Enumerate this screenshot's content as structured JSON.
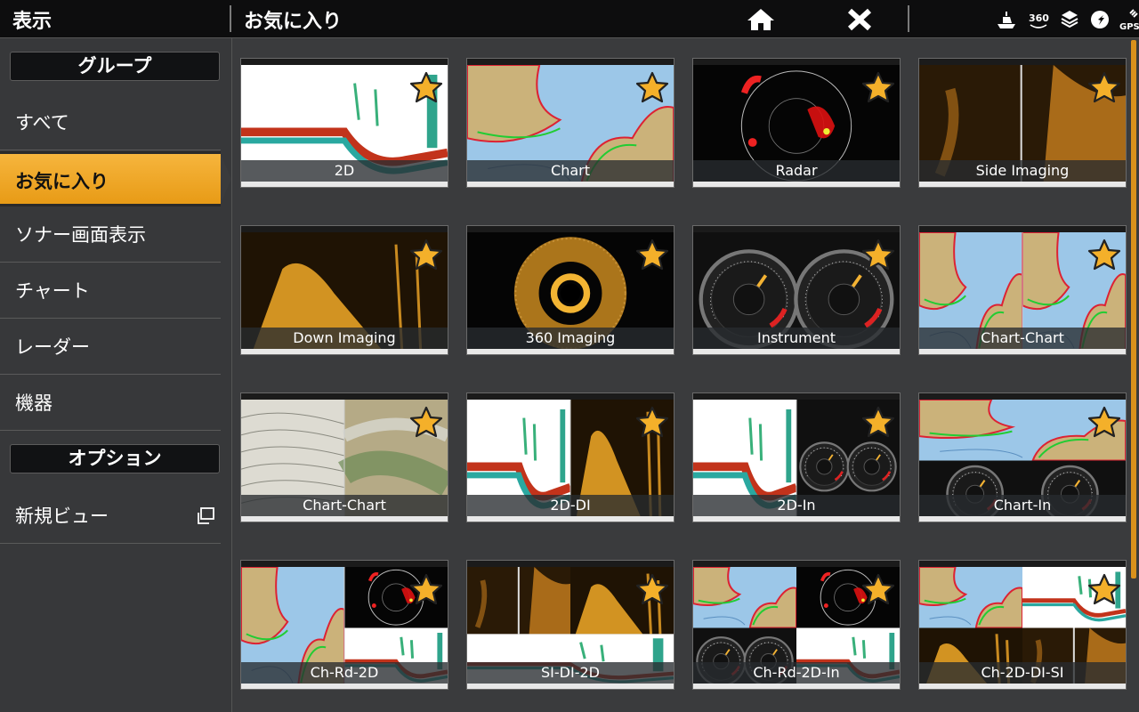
{
  "topbar": {
    "section_title": "表示",
    "view_title": "お気に入り",
    "status_icons": [
      "boat-icon",
      "360-icon",
      "layers-icon",
      "navigation-icon",
      "gps-icon"
    ],
    "gps_label": "GPS",
    "icon_360_label": "360"
  },
  "sidebar": {
    "group_header": "グループ",
    "items": [
      {
        "label": "すべて",
        "selected": false
      },
      {
        "label": "お気に入り",
        "selected": true
      },
      {
        "label": "ソナー画面表示",
        "selected": false
      },
      {
        "label": "チャート",
        "selected": false
      },
      {
        "label": "レーダー",
        "selected": false
      },
      {
        "label": "機器",
        "selected": false
      }
    ],
    "options_header": "オプション",
    "new_view_label": "新規ビュー"
  },
  "tiles": [
    {
      "label": "2D",
      "type": "sonar2d"
    },
    {
      "label": "Chart",
      "type": "chart"
    },
    {
      "label": "Radar",
      "type": "radar"
    },
    {
      "label": "Side Imaging",
      "type": "si"
    },
    {
      "label": "Down Imaging",
      "type": "di"
    },
    {
      "label": "360 Imaging",
      "type": "i360"
    },
    {
      "label": "Instrument",
      "type": "instrument"
    },
    {
      "label": "Chart-Chart",
      "type": "chartchart"
    },
    {
      "label": "Chart-Chart",
      "type": "chartsat"
    },
    {
      "label": "2D-DI",
      "type": "2ddi"
    },
    {
      "label": "2D-In",
      "type": "2din"
    },
    {
      "label": "Chart-In",
      "type": "chartin"
    },
    {
      "label": "Ch-Rd-2D",
      "type": "chrd2d"
    },
    {
      "label": "SI-DI-2D",
      "type": "sidi2d"
    },
    {
      "label": "Ch-Rd-2D-In",
      "type": "chrd2din"
    },
    {
      "label": "Ch-2D-DI-SI",
      "type": "ch2ddisi"
    }
  ],
  "colors": {
    "accent": "#eea625",
    "star": "#f4b02a",
    "background": "#3a3b3d",
    "topbar": "#0d0d0e"
  }
}
